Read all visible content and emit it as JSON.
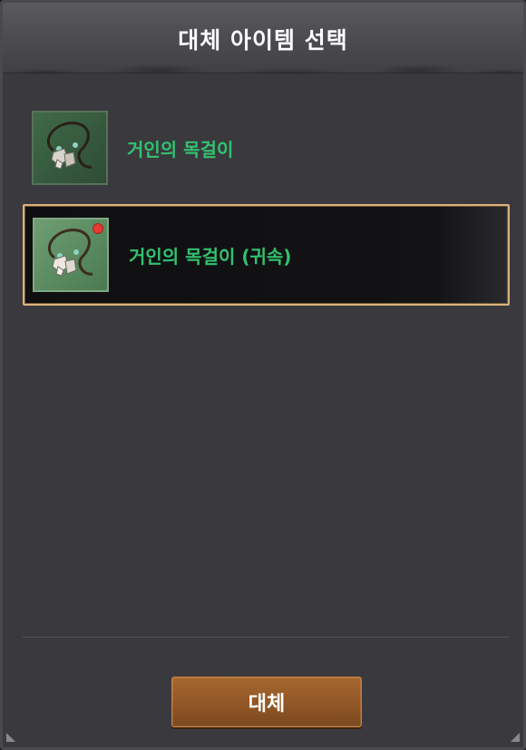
{
  "dialog": {
    "title": "대체 아이템 선택",
    "items": [
      {
        "label": "거인의 목걸이",
        "selected": false,
        "icon": "necklace-icon"
      },
      {
        "label": "거인의 목걸이 (귀속)",
        "selected": true,
        "icon": "necklace-icon",
        "badge": "red-dot"
      }
    ],
    "confirm_button": "대체"
  },
  "colors": {
    "item_name": "#32c26f",
    "selection_border": "#d9b27a",
    "button": "#9a5f2b",
    "panel": "#3a393e"
  }
}
